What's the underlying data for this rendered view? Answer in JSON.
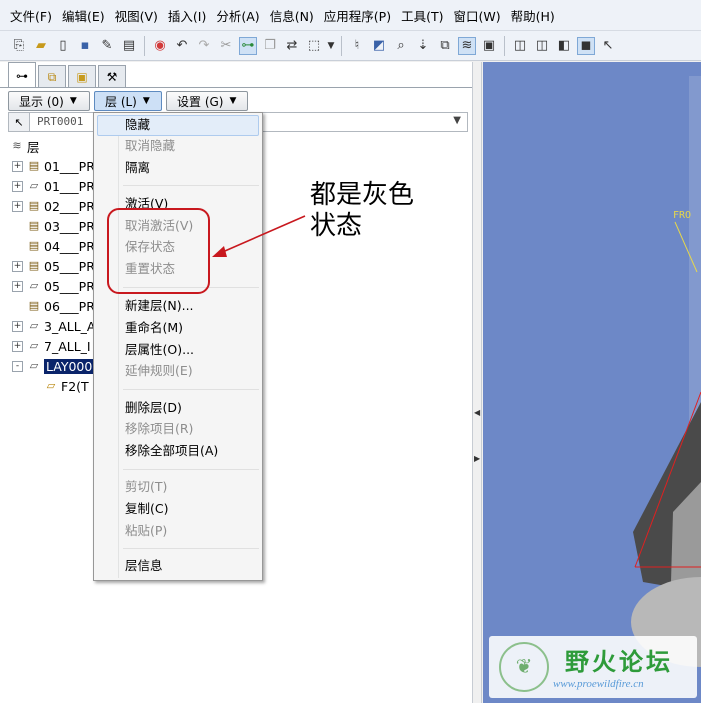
{
  "menubar": [
    "文件(F)",
    "编辑(E)",
    "视图(V)",
    "插入(I)",
    "分析(A)",
    "信息(N)",
    "应用程序(P)",
    "工具(T)",
    "窗口(W)",
    "帮助(H)"
  ],
  "toolbar": {
    "icons": [
      "new-file-icon",
      "open-icon",
      "blank-page-icon",
      "save-icon",
      "edit-icon",
      "print-icon",
      "color-wheel-icon",
      "undo-icon",
      "redo-icon",
      "cut-icon",
      "tree-toggle-icon",
      "copy-icon",
      "paste-icon",
      "select-box-icon",
      "sketch-icon",
      "zoom-fit-icon",
      "zoom-icon",
      "repaint-icon",
      "layer-icon",
      "saved-view-icon",
      "box-icon",
      "box-outline-icon",
      "box-hidden-icon",
      "box-shaded-icon",
      "help-cursor-icon"
    ]
  },
  "left_tabs": [
    "model-tree-tab",
    "layer-tree-tab",
    "folder-tab",
    "favorites-tab"
  ],
  "buttons": {
    "show": "显示 (0)",
    "layer": "层 (L)",
    "settings": "设置 (G)"
  },
  "selector": {
    "value": "PRT0001"
  },
  "tree": {
    "root": "层",
    "items": [
      {
        "label": "01___PR",
        "expander": "+",
        "icon": "layer"
      },
      {
        "label": "01___PR",
        "expander": "+",
        "icon": "plane"
      },
      {
        "label": "02___PR",
        "expander": "+",
        "icon": "layer"
      },
      {
        "label": "03___PR",
        "expander": "",
        "icon": "layer"
      },
      {
        "label": "04___PR",
        "expander": "",
        "icon": "layer"
      },
      {
        "label": "05___PR",
        "expander": "+",
        "icon": "layer"
      },
      {
        "label": "05___PR",
        "expander": "+",
        "icon": "plane"
      },
      {
        "label": "06___PR",
        "expander": "",
        "icon": "layer"
      },
      {
        "label": "3_ALL_A",
        "expander": "+",
        "icon": "plane"
      },
      {
        "label": "7_ALL_I",
        "expander": "+",
        "icon": "plane"
      },
      {
        "label": "LAY000",
        "expander": "-",
        "icon": "plane",
        "selected": true
      },
      {
        "label": "F2(T",
        "expander": "",
        "icon": "feature",
        "child": true
      }
    ]
  },
  "layer_menu": {
    "items": [
      {
        "label": "隐藏",
        "enabled": true,
        "highlighted": true
      },
      {
        "label": "取消隐藏",
        "enabled": false
      },
      {
        "label": "隔离",
        "enabled": true
      },
      {
        "label": "激活(V)",
        "enabled": true
      },
      {
        "label": "取消激活(V)",
        "enabled": false
      },
      {
        "label": "保存状态",
        "enabled": false
      },
      {
        "label": "重置状态",
        "enabled": false
      },
      {
        "label": "新建层(N)...",
        "enabled": true
      },
      {
        "label": "重命名(M)",
        "enabled": true
      },
      {
        "label": "层属性(O)...",
        "enabled": true
      },
      {
        "label": "延伸规则(E)",
        "enabled": false
      },
      {
        "label": "删除层(D)",
        "enabled": true
      },
      {
        "label": "移除项目(R)",
        "enabled": false
      },
      {
        "label": "移除全部项目(A)",
        "enabled": true
      },
      {
        "label": "剪切(T)",
        "enabled": false
      },
      {
        "label": "复制(C)",
        "enabled": true
      },
      {
        "label": "粘贴(P)",
        "enabled": false
      },
      {
        "label": "层信息",
        "enabled": true
      }
    ]
  },
  "annotation": {
    "line1": "都是灰色",
    "line2": "状态"
  },
  "viewport": {
    "datum_label": "FRO"
  },
  "watermark": {
    "title": "野火论坛",
    "url": "www.proewildfire.cn"
  },
  "colors": {
    "menu_disabled": "#8d8d8d",
    "annotation_red": "#c8181e",
    "viewport_bg": "#6d88c7",
    "selection": "#0a246a"
  }
}
